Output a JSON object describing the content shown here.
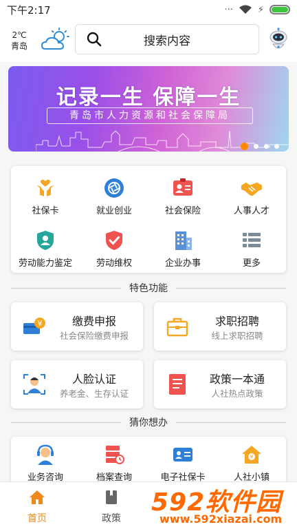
{
  "status_bar": {
    "time": "下午2:17",
    "dots": "···",
    "charging": "⚡"
  },
  "weather": {
    "temperature": "2℃",
    "city": "青岛"
  },
  "search": {
    "placeholder": "搜索内容"
  },
  "banner": {
    "title": "记录一生 保障一生",
    "subtitle": "青岛市人力资源和社会保障局",
    "slide_count": 4,
    "active_slide": 1
  },
  "services": [
    {
      "label": "社保卡",
      "icon": "hands-heart-icon",
      "color": "#f5a623"
    },
    {
      "label": "就业创业",
      "icon": "aperture-icon",
      "color": "#2e7fd8"
    },
    {
      "label": "社会保险",
      "icon": "id-card-icon",
      "color": "#ef5350"
    },
    {
      "label": "人事人才",
      "icon": "handshake-icon",
      "color": "#f5a623"
    },
    {
      "label": "劳动能力鉴定",
      "icon": "shield-person-icon",
      "color": "#26a69a"
    },
    {
      "label": "劳动维权",
      "icon": "shield-check-icon",
      "color": "#ef5350"
    },
    {
      "label": "企业办事",
      "icon": "building-icon",
      "color": "#5b8fd6"
    },
    {
      "label": "更多",
      "icon": "list-icon",
      "color": "#7d8a99"
    }
  ],
  "section_featured": "特色功能",
  "features": [
    {
      "title": "缴费申报",
      "subtitle": "社会保险缴费申报",
      "icon": "payment-card-icon"
    },
    {
      "title": "求职招聘",
      "subtitle": "线上求职招聘",
      "icon": "briefcase-icon"
    },
    {
      "title": "人脸认证",
      "subtitle": "养老金、生存认证",
      "icon": "face-scan-icon"
    },
    {
      "title": "政策一本通",
      "subtitle": "人社热点政策",
      "icon": "document-icon"
    }
  ],
  "section_guess": "猜你想办",
  "guess": [
    {
      "label": "业务咨询",
      "icon": "headset-icon"
    },
    {
      "label": "档案查询",
      "icon": "archive-icon"
    },
    {
      "label": "电子社保卡",
      "icon": "ecard-icon"
    },
    {
      "label": "人社小镇",
      "icon": "house-icon"
    }
  ],
  "tabs": [
    {
      "label": "首页",
      "icon": "home-icon",
      "active": true
    },
    {
      "label": "政策",
      "icon": "book-icon",
      "active": false
    }
  ],
  "watermark": {
    "big": "592软件园",
    "url": "www.592xiazai.com"
  },
  "colors": {
    "accent": "#f08a1a",
    "battery": "#3ec43e",
    "banner_start": "#7b5cf0",
    "banner_end": "#9ed7ee"
  }
}
